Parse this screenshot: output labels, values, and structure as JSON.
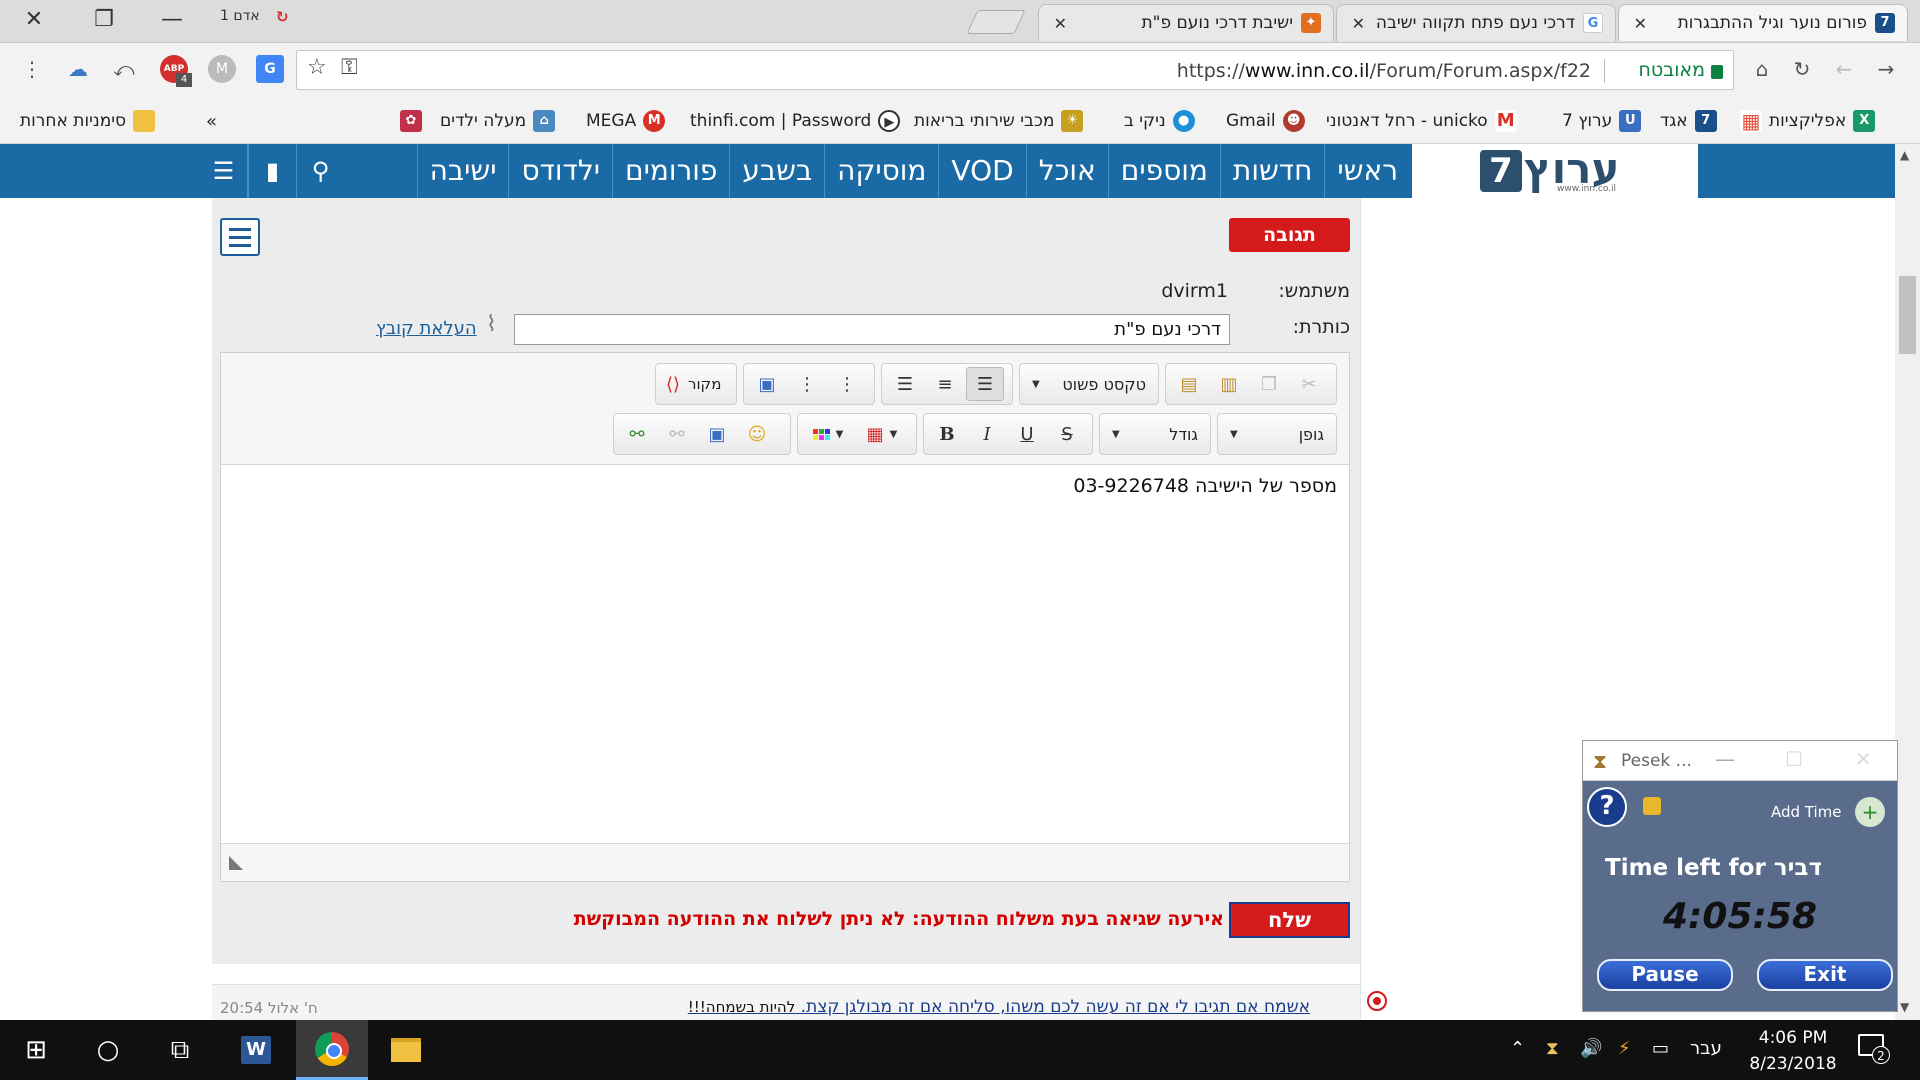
{
  "window": {
    "close_glyph": "✕",
    "restore_glyph": "❐",
    "minimize_glyph": "—",
    "profile_label": "אדם 1",
    "profile_icon": "↻"
  },
  "tabs": [
    {
      "title": "פורום נוער וגיל ההתבגרות",
      "favicon": "7",
      "favicon_color": "#1a4f8a",
      "active": true
    },
    {
      "title": "דרכי נעם פתח תקווה ישיבה",
      "favicon": "G",
      "favicon_color": "#4285f4",
      "active": false
    },
    {
      "title": "ישיבת דרכי נועם פ\"ת",
      "favicon": "✦",
      "favicon_color": "#e07020",
      "active": false
    }
  ],
  "toolbar": {
    "back_icon": "←",
    "forward_icon": "→",
    "reload_icon": "↻",
    "home_icon": "⌂",
    "secure_label": "מאובטח",
    "url_scheme": "https://",
    "url_host": "www.inn.co.il",
    "url_path": "/Forum/Forum.aspx/f22",
    "star_icon": "☆",
    "key_icon": "⚿",
    "ext_translate": "G",
    "ext_m": "M",
    "ext_abp": "ABP",
    "ext_abp_badge": "4",
    "ext_link": "⤺",
    "ext_cloud": "☁",
    "menu_icon": "⋮"
  },
  "bookmarks": [
    {
      "label": "אפליקציות",
      "icon": "▦",
      "color": "#e94f3d"
    },
    {
      "label": "אגד",
      "icon": "X",
      "color": "#1a9a6a"
    },
    {
      "label": "ערוץ 7",
      "icon": "7",
      "color": "#1a4f8a"
    },
    {
      "label": "unicko - רחל דאנטוני",
      "icon": "U",
      "color": "#3a6ec0"
    },
    {
      "label": "Gmail",
      "icon": "M",
      "color": "#d93025"
    },
    {
      "label": "ניקי ב",
      "icon": "☻",
      "color": "#b03a2e"
    },
    {
      "label": "מכבי שירותי בריאות",
      "icon": "●",
      "color": "#1f8fd8"
    },
    {
      "label": "thinfi.com | Password",
      "icon": "☀",
      "color": "#c8a020"
    },
    {
      "label": "MEGA",
      "icon": "▶",
      "color": "#444444"
    },
    {
      "label": "מעלה ילדים",
      "icon": "M",
      "color": "#d93025"
    },
    {
      "label": "",
      "icon": "⌂",
      "color": "#4a8ac0"
    },
    {
      "label": "",
      "icon": "✿",
      "color": "#c0304a"
    }
  ],
  "bookmarks_more": "»",
  "bookmarks_other": "סימניות אחרות",
  "site": {
    "logo_seven": "7",
    "logo_text": "ערוץ",
    "logo_url": "www.inn.co.il",
    "nav": [
      "ראשי",
      "חדשות",
      "מוספים",
      "אוכל",
      "VOD",
      "מוסיקה",
      "בשבע",
      "פורומים",
      "ילדודס",
      "ישיבה"
    ],
    "search_icon": "⚲",
    "chat_icon": "▮",
    "menu_icon": "☰"
  },
  "reply_form": {
    "reply_label": "תגובה",
    "user_label": "משתמש:",
    "user_value": "dvirm1",
    "subject_label": "כותרת:",
    "subject_value": "דרכי נעם פ\"ת",
    "upload_label": "העלאת קובץ",
    "editor_text": "מספר של הישיבה 03-9226748",
    "send_label": "שלח",
    "error_message": "אירעה שגיאה בעת משלוח ההודעה: לא ניתן לשלוח את ההודעה המבוקשת"
  },
  "editor_toolbar": {
    "source_label": "מקור",
    "format_label": "טקסט פשוט",
    "font_label": "גופן",
    "size_label": "גודל",
    "bold": "B",
    "italic": "I",
    "underline": "U",
    "strike": "S"
  },
  "post": {
    "title": "אשמח אם תגיבו לי אם זה עשה לכם משהו, סליחה אם זה מבולגן קצת.",
    "extra": "להיות בשמחה!!!",
    "date": "ח' אלול 20:54"
  },
  "pesek": {
    "title": "Pesek ...",
    "minimize": "—",
    "maximize": "☐",
    "close": "✕",
    "help": "?",
    "add_time_label": "Add Time",
    "add_icon": "+",
    "time_left_label": "Time left for דביר",
    "time_value": "4:05:58",
    "pause_label": "Pause",
    "exit_label": "Exit"
  },
  "taskbar": {
    "start_icon": "⊞",
    "search_icon": "○",
    "taskview_icon": "⧉",
    "word_label": "W",
    "language": "עבר",
    "time": "4:06 PM",
    "date": "8/23/2018",
    "notification_count": "2",
    "tray_up": "⌃",
    "tray_hourglass": "⧗",
    "tray_volume": "🔊",
    "tray_power": "⚡",
    "tray_network": "▭"
  },
  "scrollbar": {
    "up": "▲",
    "down": "▼"
  }
}
